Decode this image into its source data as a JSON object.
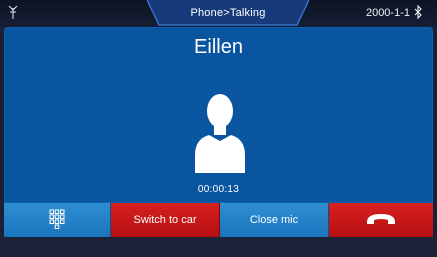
{
  "status_bar": {
    "signal_icon": "antenna-icon",
    "breadcrumb": "Phone>Talking",
    "date": "2000-1-1",
    "bluetooth_icon": "bluetooth-icon"
  },
  "call": {
    "caller_name": "Eillen",
    "avatar_icon": "person-silhouette-icon",
    "timer": "00:00:13"
  },
  "actions": {
    "keypad_icon": "dialpad-icon",
    "switch_to_car_label": "Switch to car",
    "close_mic_label": "Close mic",
    "hangup_icon": "hang-up-icon"
  },
  "colors": {
    "call_background": "#0a55a0",
    "blue_button": "#2081c8",
    "red_button": "#c81818",
    "status_bar": "#0c1325"
  }
}
